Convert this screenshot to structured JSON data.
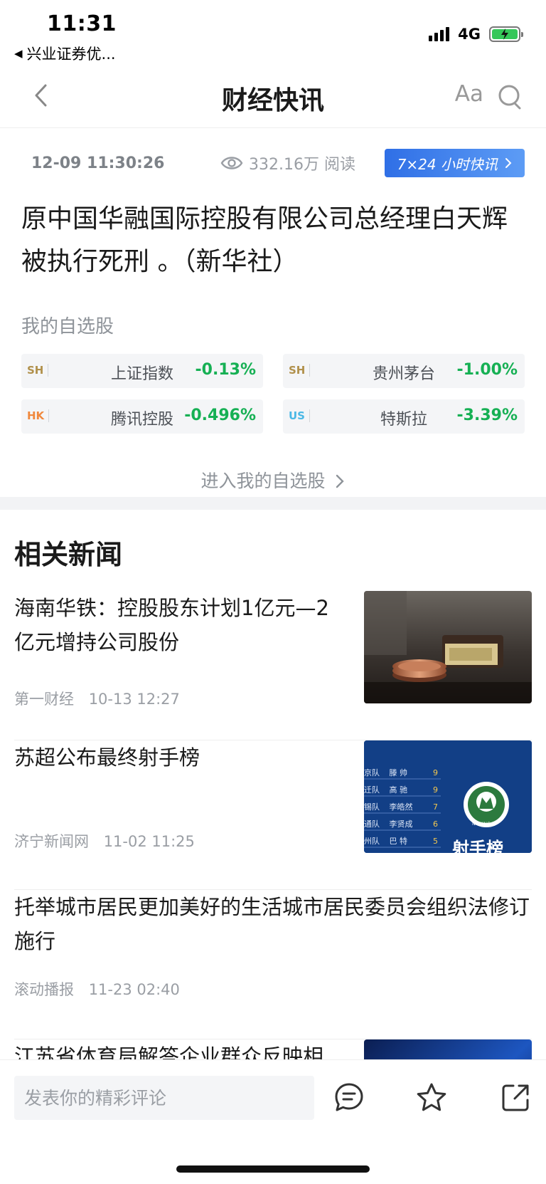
{
  "status_bar": {
    "time": "11:31",
    "back_app": "兴业证券优...",
    "network": "4G"
  },
  "nav": {
    "title": "财经快讯",
    "font_button": "Aa"
  },
  "article": {
    "datetime": "12-09 11:30:26",
    "views": "332.16万 阅读",
    "live_badge": "7×24 小时快讯",
    "headline": "原中国华融国际控股有限公司总经理白天辉被执行死刑 。（新华社）"
  },
  "watchlist": {
    "label": "我的自选股",
    "stocks": [
      {
        "market": "SH",
        "name": "上证指数",
        "change": "-0.13%"
      },
      {
        "market": "SH",
        "name": "贵州茅台",
        "change": "-1.00%"
      },
      {
        "market": "HK",
        "name": "腾讯控股",
        "change": "-0.496%"
      },
      {
        "market": "US",
        "name": "特斯拉",
        "change": "-3.39%"
      }
    ],
    "enter_link": "进入我的自选股"
  },
  "related": {
    "title": "相关新闻",
    "items": [
      {
        "title": "海南华铁：控股股东计划1亿元—2亿元增持公司股份",
        "source": "第一财经",
        "time": "10-13 12:27"
      },
      {
        "title": "苏超公布最终射手榜",
        "source": "济宁新闻网",
        "time": "11-02 11:25"
      },
      {
        "title": "托举城市居民更加美好的生活城市居民委员会组织法修订施行",
        "source": "滚动播报",
        "time": "11-23 02:40"
      },
      {
        "title": "江苏省体育局解答企业群众反映相"
      }
    ]
  },
  "thumb_ranking": {
    "rows": [
      {
        "team": "京队",
        "player": "滕 帅",
        "goals": "9"
      },
      {
        "team": "迁队",
        "player": "高 驰",
        "goals": "9"
      },
      {
        "team": "锡队",
        "player": "李皓然",
        "goals": "7"
      },
      {
        "team": "通队",
        "player": "李贤成",
        "goals": "6"
      },
      {
        "team": "州队",
        "player": "巴 特",
        "goals": "5"
      }
    ],
    "seal": "NANJING",
    "banner": "射手榜"
  },
  "bottom_bar": {
    "comment_placeholder": "发表你的精彩评论"
  },
  "colors": {
    "accent_blue": "#2f6fe6",
    "down_green": "#16b054",
    "battery_green": "#35c759"
  }
}
